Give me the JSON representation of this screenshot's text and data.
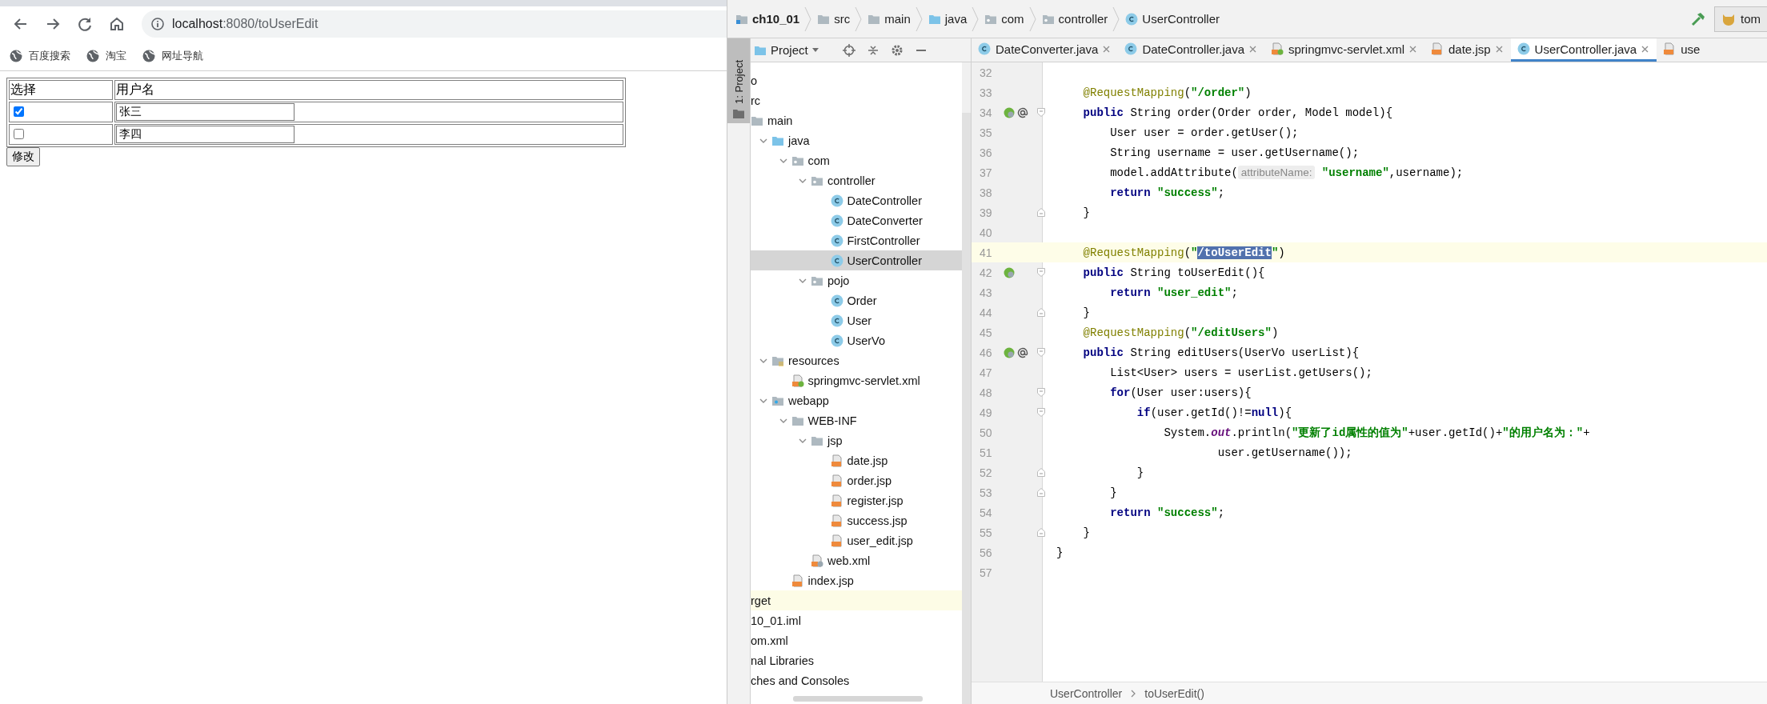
{
  "browser": {
    "url_host": "localhost",
    "url_rest": ":8080/toUserEdit",
    "bookmarks": [
      "百度搜索",
      "淘宝",
      "网址导航"
    ],
    "page": {
      "table": {
        "columns": [
          "选择",
          "用户名"
        ],
        "rows": [
          {
            "checked": true,
            "username": "张三"
          },
          {
            "checked": false,
            "username": "李四"
          }
        ]
      },
      "submit_button": "修改"
    }
  },
  "ide": {
    "breadcrumbs": [
      {
        "label": "ch10_01",
        "kind": "module"
      },
      {
        "label": "src",
        "kind": "folder"
      },
      {
        "label": "main",
        "kind": "folder"
      },
      {
        "label": "java",
        "kind": "source"
      },
      {
        "label": "com",
        "kind": "package"
      },
      {
        "label": "controller",
        "kind": "package"
      },
      {
        "label": "UserController",
        "kind": "class"
      }
    ],
    "run_config": "tom",
    "tool_stripe": "1: Project",
    "project_header": "Project",
    "tabs": [
      {
        "label": "DateConverter.java",
        "kind": "class",
        "selected": false,
        "closable": true
      },
      {
        "label": "DateController.java",
        "kind": "class",
        "selected": false,
        "closable": true
      },
      {
        "label": "springmvc-servlet.xml",
        "kind": "spring-xml",
        "selected": false,
        "closable": true
      },
      {
        "label": "date.jsp",
        "kind": "jsp",
        "selected": false,
        "closable": true
      },
      {
        "label": "UserController.java",
        "kind": "class",
        "selected": true,
        "closable": true
      },
      {
        "label": "use",
        "kind": "jsp",
        "selected": false,
        "closable": false
      }
    ],
    "tree": [
      {
        "name": "o",
        "selected": false,
        "highlighted": false
      },
      {
        "name": "rc",
        "selected": false,
        "highlighted": false,
        "children": [
          {
            "name": "main",
            "kind": "folder",
            "selected": false,
            "highlighted": false,
            "children": [
              {
                "name": "java",
                "kind": "source",
                "selected": false,
                "highlighted": false,
                "expanded": true,
                "children": [
                  {
                    "name": "com",
                    "kind": "package",
                    "selected": false,
                    "highlighted": false,
                    "expanded": true,
                    "children": [
                      {
                        "name": "controller",
                        "kind": "package",
                        "selected": false,
                        "highlighted": false,
                        "expanded": true,
                        "children": [
                          {
                            "name": "DateController",
                            "kind": "class",
                            "selected": false,
                            "highlighted": false
                          },
                          {
                            "name": "DateConverter",
                            "kind": "class",
                            "selected": false,
                            "highlighted": false
                          },
                          {
                            "name": "FirstController",
                            "kind": "class",
                            "selected": false,
                            "highlighted": false
                          },
                          {
                            "name": "UserController",
                            "kind": "class",
                            "selected": true,
                            "highlighted": false
                          }
                        ]
                      },
                      {
                        "name": "pojo",
                        "kind": "package",
                        "selected": false,
                        "highlighted": false,
                        "expanded": true,
                        "children": [
                          {
                            "name": "Order",
                            "kind": "class",
                            "selected": false,
                            "highlighted": false
                          },
                          {
                            "name": "User",
                            "kind": "class",
                            "selected": false,
                            "highlighted": false
                          },
                          {
                            "name": "UserVo",
                            "kind": "class",
                            "selected": false,
                            "highlighted": false
                          }
                        ]
                      }
                    ]
                  }
                ]
              },
              {
                "name": "resources",
                "kind": "resources",
                "selected": false,
                "highlighted": false,
                "expanded": true,
                "children": [
                  {
                    "name": "springmvc-servlet.xml",
                    "kind": "spring-xml",
                    "selected": false,
                    "highlighted": false
                  }
                ]
              },
              {
                "name": "webapp",
                "kind": "webapp",
                "selected": false,
                "highlighted": false,
                "expanded": true,
                "children": [
                  {
                    "name": "WEB-INF",
                    "kind": "folder",
                    "selected": false,
                    "highlighted": false,
                    "expanded": true,
                    "children": [
                      {
                        "name": "jsp",
                        "kind": "folder",
                        "selected": false,
                        "highlighted": false,
                        "expanded": true,
                        "children": [
                          {
                            "name": "date.jsp",
                            "kind": "jsp",
                            "selected": false,
                            "highlighted": false
                          },
                          {
                            "name": "order.jsp",
                            "kind": "jsp",
                            "selected": false,
                            "highlighted": false
                          },
                          {
                            "name": "register.jsp",
                            "kind": "jsp",
                            "selected": false,
                            "highlighted": false
                          },
                          {
                            "name": "success.jsp",
                            "kind": "jsp",
                            "selected": false,
                            "highlighted": false
                          },
                          {
                            "name": "user_edit.jsp",
                            "kind": "jsp",
                            "selected": false,
                            "highlighted": false
                          }
                        ]
                      },
                      {
                        "name": "web.xml",
                        "kind": "web-xml",
                        "selected": false,
                        "highlighted": false
                      }
                    ]
                  },
                  {
                    "name": "index.jsp",
                    "kind": "jsp",
                    "selected": false,
                    "highlighted": false
                  }
                ]
              }
            ]
          }
        ]
      },
      {
        "name": "rget",
        "selected": false,
        "highlighted": true
      },
      {
        "name": "10_01.iml",
        "selected": false,
        "highlighted": false
      },
      {
        "name": "om.xml",
        "selected": false,
        "highlighted": false
      },
      {
        "name": "nal Libraries",
        "selected": false,
        "highlighted": false
      },
      {
        "name": "ches and Consoles",
        "selected": false,
        "highlighted": false
      }
    ],
    "code": [
      {
        "number": "32",
        "current": false
      },
      {
        "number": "33",
        "current": false,
        "tokens": [
          {
            "kind": "annotation",
            "text": "    @RequestMapping"
          },
          {
            "kind": "plain",
            "text": "("
          },
          {
            "kind": "string",
            "text": "\"/order\""
          },
          {
            "kind": "plain",
            "text": ")"
          }
        ]
      },
      {
        "number": "34",
        "current": false,
        "gutter": [
          {
            "kind": "bean"
          },
          {
            "kind": "at"
          },
          {
            "kind": "fold-open"
          }
        ],
        "tokens": [
          {
            "kind": "keyword",
            "text": "    public"
          },
          {
            "kind": "plain",
            "text": " String order(Order order, Model model){"
          }
        ]
      },
      {
        "number": "35",
        "current": false,
        "tokens": [
          {
            "kind": "plain",
            "text": "        User user = order.getUser();"
          }
        ]
      },
      {
        "number": "36",
        "current": false,
        "tokens": [
          {
            "kind": "plain",
            "text": "        String username = user.getUsername();"
          }
        ]
      },
      {
        "number": "37",
        "current": false,
        "tokens": [
          {
            "kind": "plain",
            "text": "        model.addAttribute("
          },
          {
            "kind": "hint",
            "text": "attributeName:"
          },
          {
            "kind": "string",
            "text": " \"username\""
          },
          {
            "kind": "plain",
            "text": ",username);"
          }
        ]
      },
      {
        "number": "38",
        "current": false,
        "tokens": [
          {
            "kind": "keyword",
            "text": "        return"
          },
          {
            "kind": "string",
            "text": " \"success\""
          },
          {
            "kind": "plain",
            "text": ";"
          }
        ]
      },
      {
        "number": "39",
        "current": false,
        "gutter": [
          {
            "kind": "fold-close"
          }
        ],
        "tokens": [
          {
            "kind": "plain",
            "text": "    }"
          }
        ]
      },
      {
        "number": "40",
        "current": false
      },
      {
        "number": "41",
        "current": true,
        "tokens": [
          {
            "kind": "annotation",
            "text": "    @RequestMapping"
          },
          {
            "kind": "plain",
            "text": "("
          },
          {
            "kind": "string",
            "text": "\""
          },
          {
            "kind": "selection",
            "text": "/toUserEdit"
          },
          {
            "kind": "string",
            "text": "\""
          },
          {
            "kind": "plain",
            "text": ")"
          }
        ]
      },
      {
        "number": "42",
        "current": false,
        "gutter": [
          {
            "kind": "bean"
          },
          {
            "kind": "fold-open"
          }
        ],
        "tokens": [
          {
            "kind": "keyword",
            "text": "    public"
          },
          {
            "kind": "plain",
            "text": " String toUserEdit(){"
          }
        ]
      },
      {
        "number": "43",
        "current": false,
        "tokens": [
          {
            "kind": "keyword",
            "text": "        return"
          },
          {
            "kind": "string",
            "text": " \"user_edit\""
          },
          {
            "kind": "plain",
            "text": ";"
          }
        ]
      },
      {
        "number": "44",
        "current": false,
        "gutter": [
          {
            "kind": "fold-close"
          }
        ],
        "tokens": [
          {
            "kind": "plain",
            "text": "    }"
          }
        ]
      },
      {
        "number": "45",
        "current": false,
        "tokens": [
          {
            "kind": "annotation",
            "text": "    @RequestMapping"
          },
          {
            "kind": "plain",
            "text": "("
          },
          {
            "kind": "string",
            "text": "\"/editUsers\""
          },
          {
            "kind": "plain",
            "text": ")"
          }
        ]
      },
      {
        "number": "46",
        "current": false,
        "gutter": [
          {
            "kind": "bean"
          },
          {
            "kind": "at"
          },
          {
            "kind": "fold-open"
          }
        ],
        "tokens": [
          {
            "kind": "keyword",
            "text": "    public"
          },
          {
            "kind": "plain",
            "text": " String editUsers(UserVo userList){"
          }
        ]
      },
      {
        "number": "47",
        "current": false,
        "tokens": [
          {
            "kind": "plain",
            "text": "        List<User> users = userList.getUsers();"
          }
        ]
      },
      {
        "number": "48",
        "current": false,
        "gutter": [
          {
            "kind": "fold-open"
          }
        ],
        "tokens": [
          {
            "kind": "keyword",
            "text": "        for"
          },
          {
            "kind": "plain",
            "text": "(User user:users){"
          }
        ]
      },
      {
        "number": "49",
        "current": false,
        "gutter": [
          {
            "kind": "fold-open"
          }
        ],
        "tokens": [
          {
            "kind": "keyword",
            "text": "            if"
          },
          {
            "kind": "plain",
            "text": "(user.getId()!="
          },
          {
            "kind": "keyword",
            "text": "null"
          },
          {
            "kind": "plain",
            "text": "){"
          }
        ]
      },
      {
        "number": "50",
        "current": false,
        "tokens": [
          {
            "kind": "plain",
            "text": "                System."
          },
          {
            "kind": "static",
            "text": "out"
          },
          {
            "kind": "plain",
            "text": ".println("
          },
          {
            "kind": "string",
            "text": "\"更新了id属性的值为\""
          },
          {
            "kind": "plain",
            "text": "+user.getId()+"
          },
          {
            "kind": "string",
            "text": "\"的用户名为：\""
          },
          {
            "kind": "plain",
            "text": "+"
          }
        ]
      },
      {
        "number": "51",
        "current": false,
        "tokens": [
          {
            "kind": "plain",
            "text": "                        user.getUsername());"
          }
        ]
      },
      {
        "number": "52",
        "current": false,
        "gutter": [
          {
            "kind": "fold-close"
          }
        ],
        "tokens": [
          {
            "kind": "plain",
            "text": "            }"
          }
        ]
      },
      {
        "number": "53",
        "current": false,
        "gutter": [
          {
            "kind": "fold-close"
          }
        ],
        "tokens": [
          {
            "kind": "plain",
            "text": "        }"
          }
        ]
      },
      {
        "number": "54",
        "current": false,
        "tokens": [
          {
            "kind": "keyword",
            "text": "        return"
          },
          {
            "kind": "string",
            "text": " \"success\""
          },
          {
            "kind": "plain",
            "text": ";"
          }
        ]
      },
      {
        "number": "55",
        "current": false,
        "gutter": [
          {
            "kind": "fold-close"
          }
        ],
        "tokens": [
          {
            "kind": "plain",
            "text": "    }"
          }
        ]
      },
      {
        "number": "56",
        "current": false,
        "tokens": [
          {
            "kind": "plain",
            "text": "}"
          }
        ]
      },
      {
        "number": "57",
        "current": false
      }
    ],
    "status_breadcrumbs": [
      "UserController",
      "toUserEdit()"
    ]
  }
}
